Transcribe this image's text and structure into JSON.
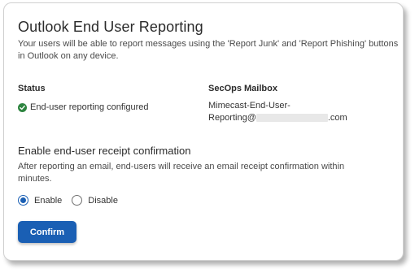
{
  "panel": {
    "title": "Outlook End User Reporting",
    "description": "Your users will be able to report messages using the 'Report Junk' and 'Report Phishing' buttons in Outlook on any device."
  },
  "status": {
    "label": "Status",
    "value": "End-user reporting configured",
    "icon": "check-circle-icon",
    "color": "#2e8540"
  },
  "mailbox": {
    "label": "SecOps Mailbox",
    "line1": "Mimecast-End-User-",
    "line2_prefix": "Reporting@",
    "line2_suffix": ".com"
  },
  "receipt": {
    "title": "Enable end-user receipt confirmation",
    "description": "After reporting an email, end-users will receive an email receipt confirmation within minutes.",
    "options": [
      {
        "label": "Enable",
        "selected": true
      },
      {
        "label": "Disable",
        "selected": false
      }
    ]
  },
  "actions": {
    "confirm_label": "Confirm",
    "accent": "#1a5fb4"
  }
}
